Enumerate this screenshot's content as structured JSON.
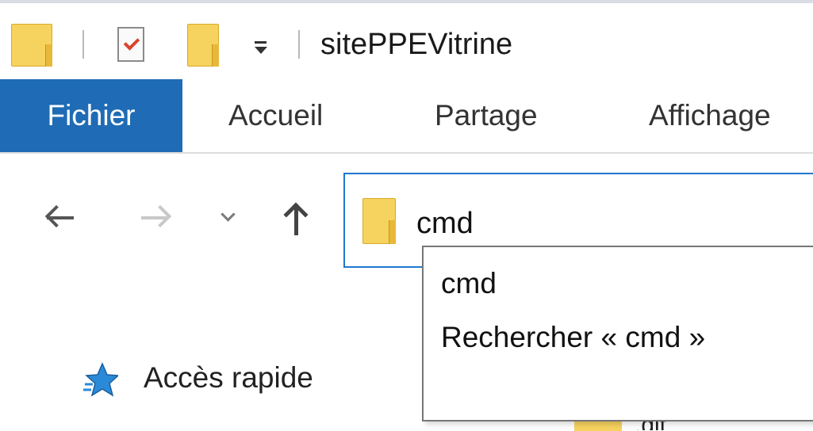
{
  "window": {
    "title": "sitePPEVitrine"
  },
  "ribbon": {
    "tabs": [
      {
        "label": "Fichier",
        "active": true
      },
      {
        "label": "Accueil"
      },
      {
        "label": "Partage"
      },
      {
        "label": "Affichage"
      }
    ]
  },
  "address_bar": {
    "value": "cmd"
  },
  "autocomplete": {
    "items": [
      {
        "label": "cmd"
      },
      {
        "label": "Rechercher « cmd »"
      }
    ]
  },
  "navigation_pane": {
    "quick_access_label": "Accès rapide"
  },
  "content_peek": {
    "text": ".git"
  },
  "icons": {
    "qat_folder": "folder-icon",
    "properties": "properties-check-icon",
    "new_folder": "new-folder-icon",
    "customize": "customize-toolbar-icon",
    "back": "back-arrow-icon",
    "forward": "forward-arrow-icon",
    "recent": "chevron-down-icon",
    "up": "up-arrow-icon",
    "address_folder": "folder-icon",
    "quick_access": "star-icon"
  },
  "colors": {
    "accent": "#1f6bb5",
    "address_focus": "#1e78d0",
    "folder": "#f6d25f"
  }
}
